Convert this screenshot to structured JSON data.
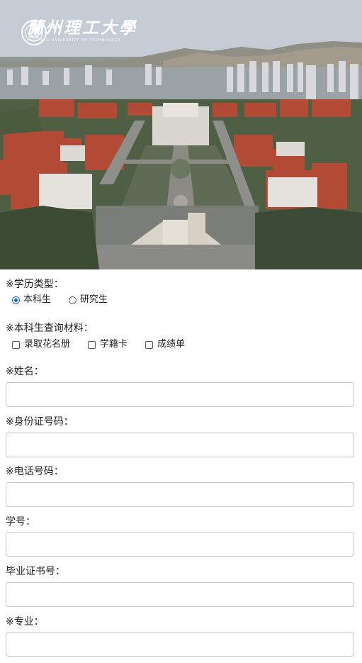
{
  "header": {
    "logo_cn": "蘭州理工大學",
    "logo_en": "LANZHOU UNIVERSITY OF TECHNOLOGY"
  },
  "form": {
    "education_type": {
      "label": "※学历类型：",
      "options": [
        {
          "label": "本科生",
          "selected": true
        },
        {
          "label": "研究生",
          "selected": false
        }
      ]
    },
    "materials": {
      "label": "※本科生查询材料：",
      "options": [
        {
          "label": "录取花名册",
          "checked": false
        },
        {
          "label": "学籍卡",
          "checked": false
        },
        {
          "label": "成绩单",
          "checked": false
        }
      ]
    },
    "name": {
      "label": "※姓名：",
      "value": ""
    },
    "id_number": {
      "label": "※身份证号码：",
      "value": ""
    },
    "phone": {
      "label": "※电话号码：",
      "value": ""
    },
    "student_no": {
      "label": "学号：",
      "value": ""
    },
    "diploma_no": {
      "label": "毕业证书号：",
      "value": ""
    },
    "major": {
      "label": "※专业：",
      "value": ""
    }
  },
  "colors": {
    "radio_accent": "#0a66d6",
    "field_border": "#c8c8c8"
  }
}
